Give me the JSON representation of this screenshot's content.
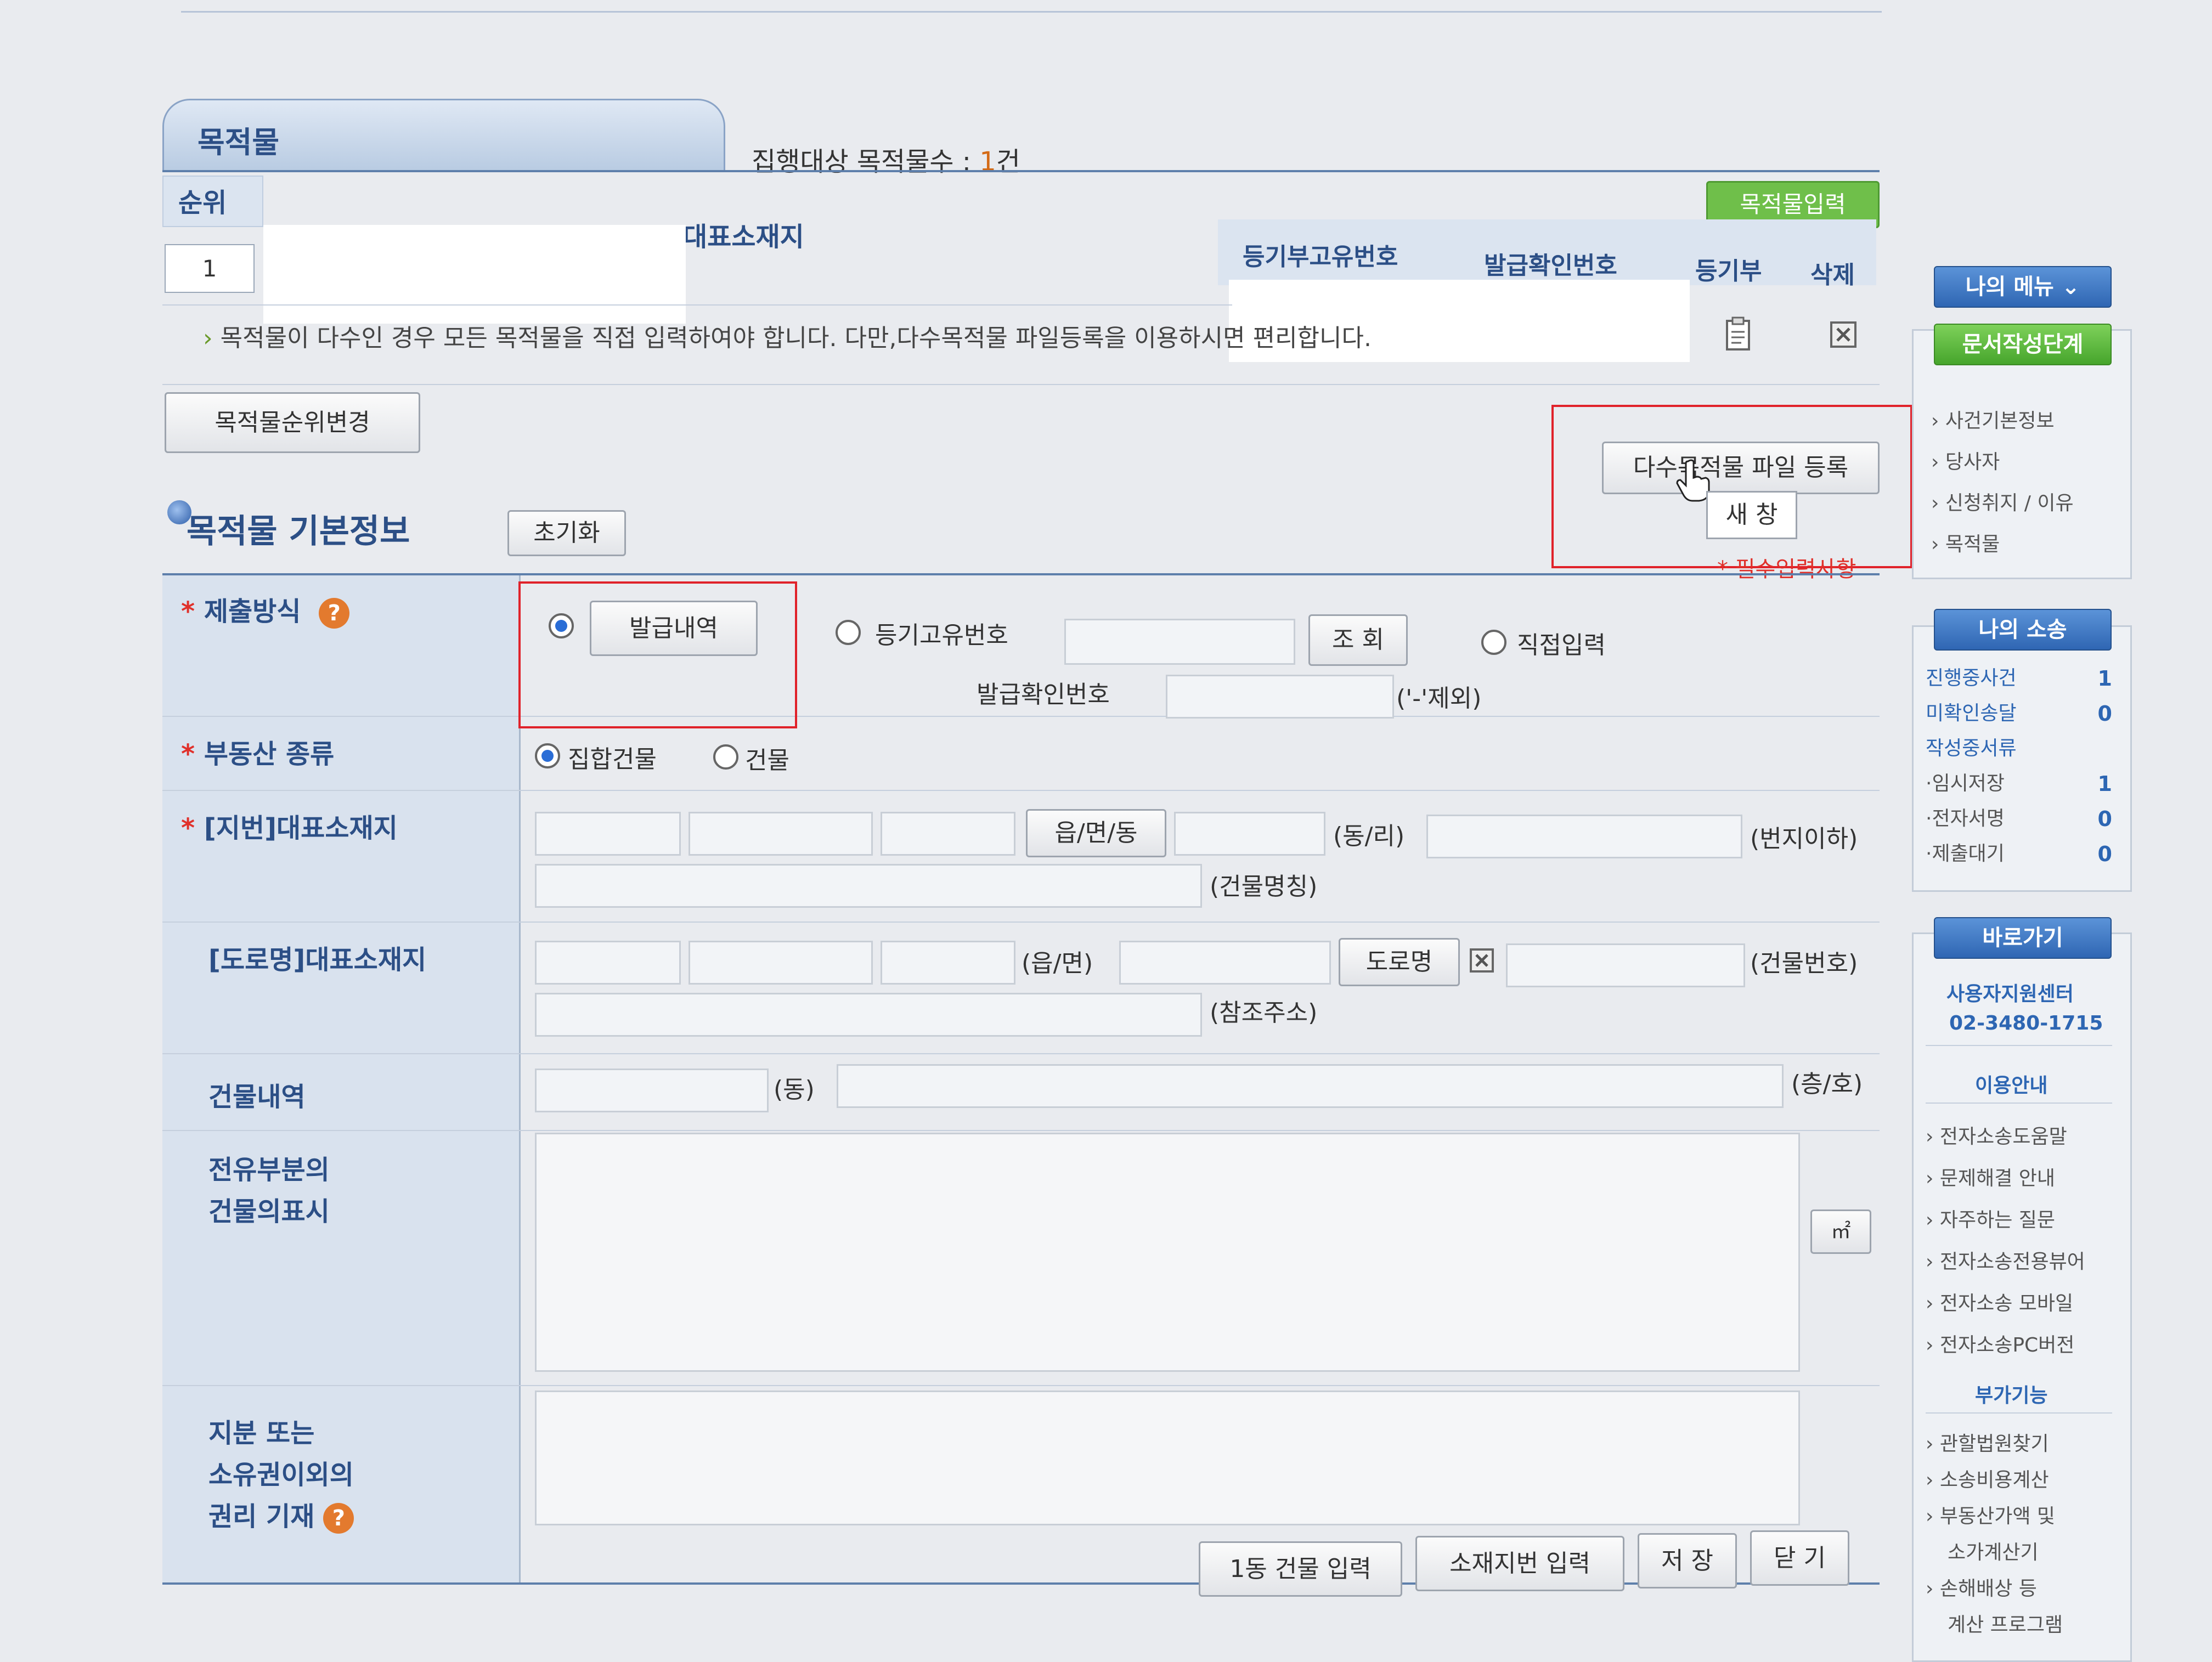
{
  "tab": {
    "label": "목적물"
  },
  "summary": {
    "label": "집행대상 목적물수 :",
    "count": "1",
    "unit": "건"
  },
  "buttons": {
    "add_target": "목적물입력",
    "reorder": "목적물순위변경",
    "reset": "초기화",
    "bulk_upload": "다수목적물 파일 등록",
    "tooltip": "새 창",
    "lookup": "조 회",
    "eupmyeondong": "읍/면/동",
    "road_name": "도로명",
    "building_input": "1동 건물 입력",
    "lot_input": "소재지번 입력",
    "save": "저 장",
    "close": "닫 기",
    "unit_m2": "㎡"
  },
  "table": {
    "headers": {
      "seq": "순위",
      "address": "대표소재지",
      "reg_no": "등기부고유번호",
      "issue_no": "발급확인번호",
      "registry": "등기부",
      "delete": "삭제"
    },
    "row": {
      "seq": "1"
    }
  },
  "note": "목적물이 다수인 경우 모든 목적물을 직접 입력하여야 합니다. 다만,다수목적물 파일등록을 이용하시면 편리합니다.",
  "section": {
    "title": "목적물 기본정보",
    "required_note": "* 필수입력사항"
  },
  "form": {
    "submit_method": {
      "label": "제출방식",
      "opt_issue": "발급내역",
      "opt_regno": "등기고유번호",
      "opt_direct": "직접입력",
      "issue_no_label": "발급확인번호",
      "issue_no_hint": "('-'제외)"
    },
    "property_type": {
      "label": "부동산 종류",
      "opt_collective": "집합건물",
      "opt_building": "건물"
    },
    "lot_address": {
      "label": "[지번]대표소재지",
      "dongri": "(동/리)",
      "bunji": "(번지이하)",
      "building_name": "(건물명칭)"
    },
    "road_address": {
      "label": "[도로명]대표소재지",
      "eupmyeon": "(읍/면)",
      "building_no": "(건물번호)",
      "ref_addr": "(참조주소)"
    },
    "building": {
      "label": "건물내역",
      "dong": "(동)",
      "floor_unit": "(층/호)"
    },
    "exclusive": {
      "label_line1": "전유부분의",
      "label_line2": "건물의표시"
    },
    "rights": {
      "label_line1": "지분 또는",
      "label_line2": "소유권이외의",
      "label_line3": "권리 기재"
    }
  },
  "sidebar": {
    "my_menu": "나의 메뉴 ⌄",
    "doc_stage": "문서작성단계",
    "stage_items": [
      "사건기본정보",
      "당사자",
      "신청취지 / 이유",
      "목적물"
    ],
    "my_case": "나의 소송",
    "case_items": [
      {
        "label": "진행중사건",
        "value": "1"
      },
      {
        "label": "미확인송달",
        "value": "0"
      },
      {
        "label": "작성중서류",
        "value": ""
      },
      {
        "label": "·임시저장",
        "value": "1"
      },
      {
        "label": "·전자서명",
        "value": "0"
      },
      {
        "label": "·제출대기",
        "value": "0"
      }
    ],
    "shortcut": "바로가기",
    "support_center": "사용자지원센터",
    "support_phone": "02-3480-1715",
    "guide_title": "이용안내",
    "guide_items": [
      "전자소송도움말",
      "문제해결 안내",
      "자주하는 질문",
      "전자소송전용뷰어",
      "전자소송 모바일",
      "전자소송PC버전"
    ],
    "extra_title": "부가기능",
    "extra_items": [
      "관할법원찾기",
      "소송비용계산",
      "부동산가액 및",
      "소가계산기",
      "손해배상 등",
      "계산 프로그램"
    ]
  }
}
